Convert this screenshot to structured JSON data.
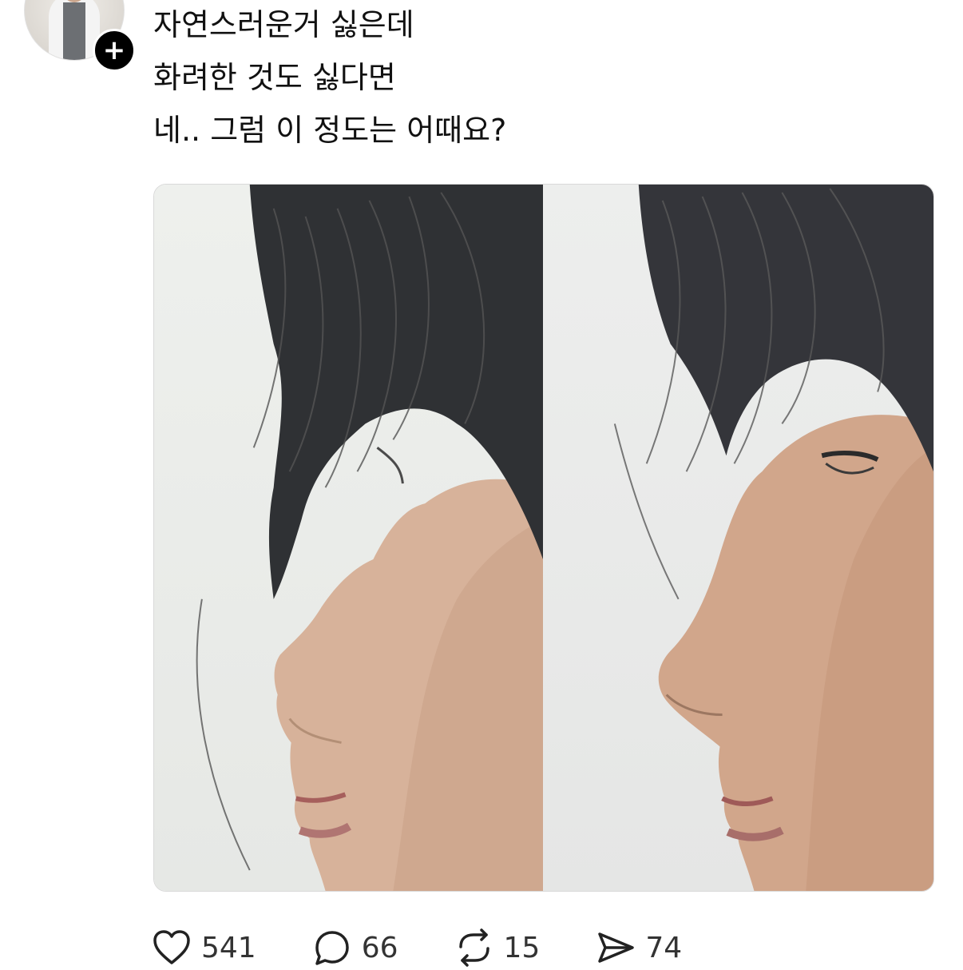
{
  "post": {
    "lines": [
      "자연스러운거 싫은데",
      "화려한 것도 싫다면",
      "네.. 그럼 이 정도는 어때요?"
    ],
    "follow_symbol": "+"
  },
  "actions": {
    "like": {
      "icon": "heart-icon",
      "count": "541"
    },
    "reply": {
      "icon": "comment-icon",
      "count": "66"
    },
    "repost": {
      "icon": "repost-icon",
      "count": "15"
    },
    "share": {
      "icon": "send-icon",
      "count": "74"
    }
  }
}
